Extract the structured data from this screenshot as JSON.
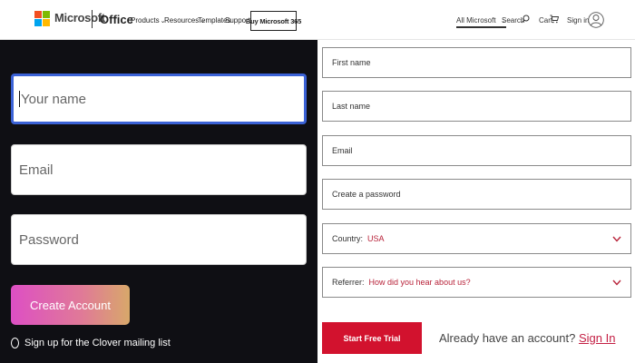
{
  "header": {
    "brand": "Microsoft",
    "product": "Office",
    "nav": [
      "Products",
      "Resources",
      "Templates",
      "Support"
    ],
    "buy_label": "Buy Microsoft 365",
    "all_microsoft": "All Microsoft",
    "search_label": "Search",
    "cart_label": "Cart",
    "signin_label": "Sign in",
    "icons": [
      "microsoft-logo",
      "search-icon",
      "cart-icon",
      "avatar-icon",
      "chevron-down-icon"
    ]
  },
  "left_form": {
    "name_placeholder": "Your name",
    "email_placeholder": "Email",
    "password_placeholder": "Password",
    "create_label": "Create Account",
    "mailing_label": "Sign up for the Clover mailing list",
    "button_gradient": [
      "#dd4fc4",
      "#d8a86a"
    ],
    "focus_color": "#3b62d6"
  },
  "right_form": {
    "first_name": "First name",
    "last_name": "Last name",
    "email": "Email",
    "password": "Create a password",
    "country_label": "Country:",
    "country_value": "USA",
    "referrer_label": "Referrer:",
    "referrer_value": "How did you hear about us?",
    "trial_label": "Start Free Trial",
    "already_text": "Already have an account?",
    "signin_link": "Sign In",
    "accent": "#d2122e"
  }
}
